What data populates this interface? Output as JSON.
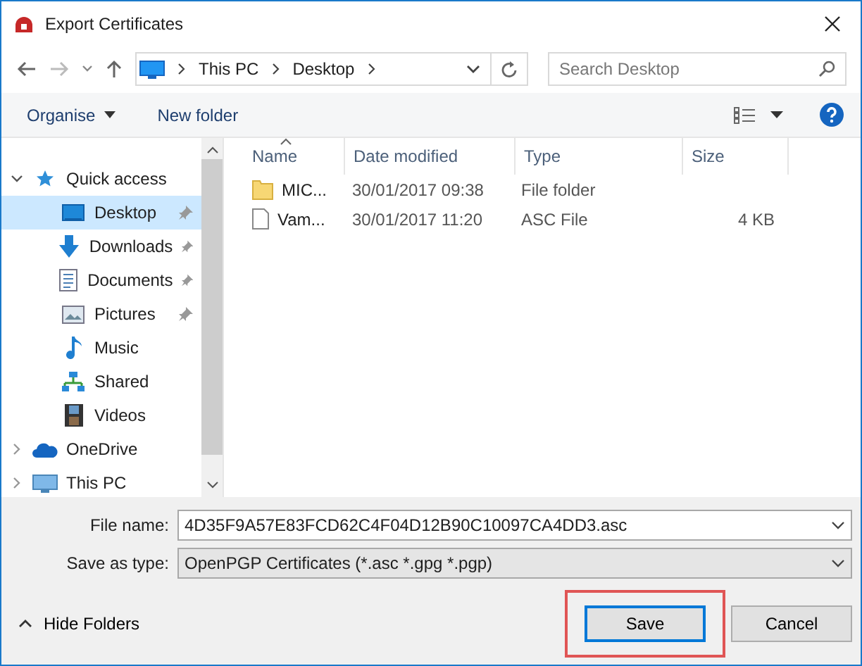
{
  "window": {
    "title": "Export Certificates"
  },
  "address": {
    "crumbs": [
      "This PC",
      "Desktop"
    ]
  },
  "search": {
    "placeholder": "Search Desktop"
  },
  "toolbar": {
    "organise": "Organise",
    "new_folder": "New folder"
  },
  "sidebar": {
    "items": [
      {
        "kind": "star",
        "label": "Quick access",
        "expanded": true,
        "selected": false,
        "children": [
          {
            "kind": "desktop",
            "label": "Desktop",
            "pinned": true,
            "selected": true
          },
          {
            "kind": "download",
            "label": "Downloads",
            "pinned": true,
            "selected": false
          },
          {
            "kind": "document",
            "label": "Documents",
            "pinned": true,
            "selected": false
          },
          {
            "kind": "pictures",
            "label": "Pictures",
            "pinned": true,
            "selected": false
          },
          {
            "kind": "music",
            "label": "Music",
            "pinned": false,
            "selected": false
          },
          {
            "kind": "shared",
            "label": "Shared",
            "pinned": false,
            "selected": false
          },
          {
            "kind": "videos",
            "label": "Videos",
            "pinned": false,
            "selected": false
          }
        ]
      },
      {
        "kind": "cloud",
        "label": "OneDrive",
        "expanded": false,
        "selected": false
      },
      {
        "kind": "pc",
        "label": "This PC",
        "expanded": false,
        "selected": false
      }
    ]
  },
  "table": {
    "columns": [
      {
        "label": "Name",
        "sorted": true
      },
      {
        "label": "Date modified",
        "sorted": false
      },
      {
        "label": "Type",
        "sorted": false
      },
      {
        "label": "Size",
        "sorted": false
      }
    ],
    "rows": [
      {
        "kind": "folder",
        "name": "MIC...",
        "date": "30/01/2017 09:38",
        "type": "File folder",
        "size": ""
      },
      {
        "kind": "file",
        "name": "Vam...",
        "date": "30/01/2017 11:20",
        "type": "ASC File",
        "size": "4 KB"
      }
    ]
  },
  "footer": {
    "file_name_label": "File name:",
    "file_name": "4D35F9A57E83FCD62C4F04D12B90C10097CA4DD3.asc",
    "type_label": "Save as type:",
    "type": "OpenPGP Certificates (*.asc *.gpg *.pgp)",
    "hide_folders": "Hide Folders",
    "buttons": [
      {
        "label": "Save",
        "default": true,
        "highlighted": true
      },
      {
        "label": "Cancel",
        "default": false,
        "highlighted": false
      }
    ]
  }
}
